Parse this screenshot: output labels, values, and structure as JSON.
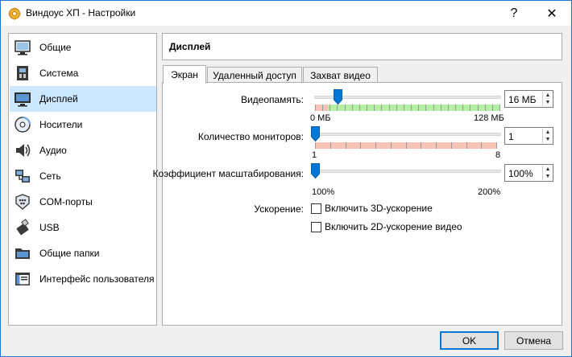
{
  "window": {
    "title": "Виндоус ХП - Настройки",
    "help_label": "?",
    "close_label": "✕"
  },
  "sidebar": {
    "items": [
      {
        "label": "Общие",
        "icon": "monitor-general-icon"
      },
      {
        "label": "Система",
        "icon": "motherboard-icon"
      },
      {
        "label": "Дисплей",
        "icon": "display-icon",
        "selected": true
      },
      {
        "label": "Носители",
        "icon": "disk-icon"
      },
      {
        "label": "Аудио",
        "icon": "speaker-icon"
      },
      {
        "label": "Сеть",
        "icon": "network-icon"
      },
      {
        "label": "COM-порты",
        "icon": "serial-port-icon"
      },
      {
        "label": "USB",
        "icon": "usb-icon"
      },
      {
        "label": "Общие папки",
        "icon": "shared-folder-icon"
      },
      {
        "label": "Интерфейс пользователя",
        "icon": "user-interface-icon"
      }
    ]
  },
  "header": {
    "title": "Дисплей"
  },
  "tabs": [
    {
      "label": "Экран",
      "active": true
    },
    {
      "label": "Удаленный доступ",
      "active": false
    },
    {
      "label": "Захват видео",
      "active": false
    }
  ],
  "screen": {
    "video_memory": {
      "label": "Видеопамять:",
      "value": "16 МБ",
      "min_label": "0 МБ",
      "max_label": "128 МБ",
      "fraction": 0.125
    },
    "monitors": {
      "label": "Количество мониторов:",
      "value": "1",
      "min_label": "1",
      "max_label": "8",
      "fraction": 0
    },
    "scale": {
      "label": "Коэффициент масштабирования:",
      "value": "100%",
      "min_label": "100%",
      "max_label": "200%",
      "fraction": 0
    },
    "acceleration": {
      "label": "Ускорение:",
      "options": [
        {
          "label": "Включить 3D-ускорение",
          "checked": false
        },
        {
          "label": "Включить 2D-ускорение видео",
          "checked": false
        }
      ]
    }
  },
  "buttons": {
    "ok": "OK",
    "cancel": "Отмена"
  },
  "colors": {
    "accent": "#0078d7",
    "selection": "#cce8ff",
    "scale_good": "#b4f0a4",
    "scale_bad": "#f7c3b4"
  }
}
